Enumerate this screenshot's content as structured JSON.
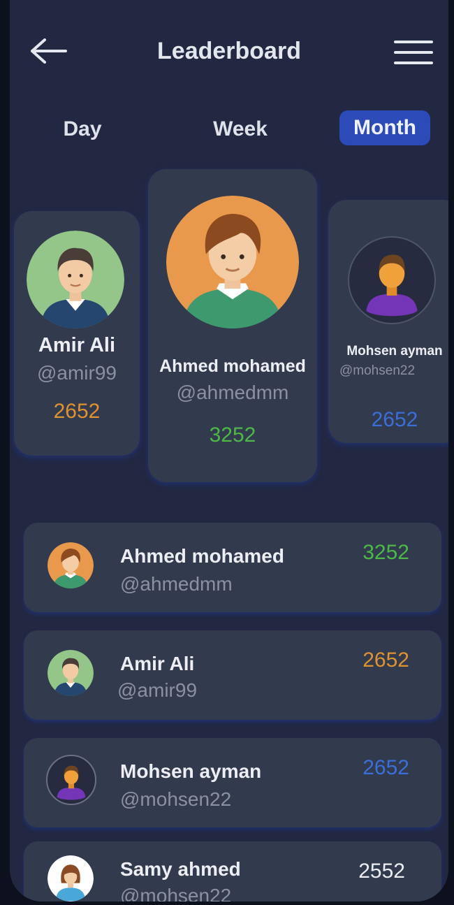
{
  "header": {
    "title": "Leaderboard"
  },
  "tabs": [
    {
      "label": "Day"
    },
    {
      "label": "Week"
    },
    {
      "label": "Month",
      "active": true
    }
  ],
  "podium": {
    "left": {
      "name": "Amir  Ali",
      "handle": "@amir99",
      "score": "2652",
      "score_color": "#e0922f"
    },
    "center": {
      "name": "Ahmed mohamed",
      "handle": "@ahmedmm",
      "score": "3252",
      "score_color": "#4db848"
    },
    "right": {
      "name": "Mohsen ayman",
      "handle": "@mohsen22",
      "score": "2652",
      "score_color": "#3b6fd8"
    }
  },
  "list": [
    {
      "name": "Ahmed mohamed",
      "handle": "@ahmedmm",
      "score": "3252",
      "score_color": "#4db848"
    },
    {
      "name": "Amir  Ali",
      "handle": "@amir99",
      "score": "2652",
      "score_color": "#e0922f"
    },
    {
      "name": "Mohsen ayman",
      "handle": "@mohsen22",
      "score": "2652",
      "score_color": "#3b6fd8"
    },
    {
      "name": "Samy ahmed",
      "handle": "@mohsen22",
      "score": "2552",
      "score_color": "#eceef3"
    }
  ],
  "colors": {
    "background": "#222842",
    "card": "#323a4e",
    "accent": "#2c4ab8"
  },
  "icons": {
    "back": "arrow-left-icon",
    "menu": "hamburger-menu-icon"
  }
}
